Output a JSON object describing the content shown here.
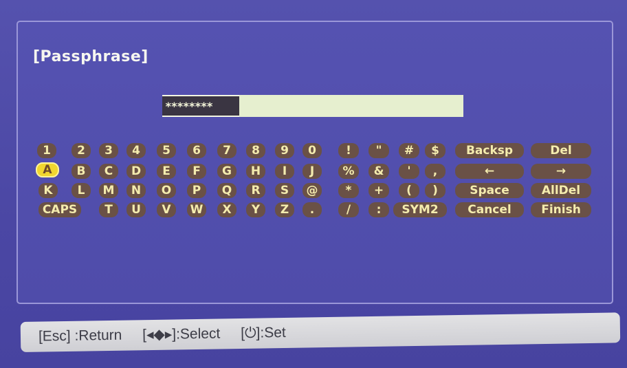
{
  "panel": {
    "title": "[Passphrase]"
  },
  "passphrase_field": {
    "masked_value": "********"
  },
  "keyboard": {
    "row1": [
      "1",
      "2",
      "3",
      "4",
      "5",
      "6",
      "7",
      "8",
      "9",
      "0"
    ],
    "row2": [
      "A",
      "B",
      "C",
      "D",
      "E",
      "F",
      "G",
      "H",
      "I",
      "J"
    ],
    "row3": [
      "K",
      "L",
      "M",
      "N",
      "O",
      "P",
      "Q",
      "R",
      "S",
      "@"
    ],
    "row4": [
      "CAPS",
      "T",
      "U",
      "V",
      "W",
      "X",
      "Y",
      "Z",
      "."
    ],
    "symbols": {
      "row1": [
        "!",
        "\"",
        "#",
        "$"
      ],
      "row2": [
        "%",
        "&",
        "'",
        ","
      ],
      "row3": [
        "*",
        "+",
        "(",
        ")"
      ],
      "row4": [
        "/",
        ":",
        "SYM2"
      ]
    },
    "functions": {
      "backspace": "Backsp",
      "delete": "Del",
      "left": "←",
      "right": "→",
      "space": "Space",
      "all_delete": "AllDel",
      "cancel": "Cancel",
      "finish": "Finish"
    },
    "selected_key": "A"
  },
  "footer": {
    "esc_hint": "[Esc] :Return",
    "select_hint": "[◂◆▸]:Select",
    "set_hint": "[⏻]:Set"
  },
  "colors": {
    "background": "#4f4aa6",
    "key_background": "#6a5146",
    "key_text": "#f4ecae",
    "selected_key": "#f1d62f",
    "field_background": "#e6efcf",
    "footer_background": "#d8d8dc"
  }
}
